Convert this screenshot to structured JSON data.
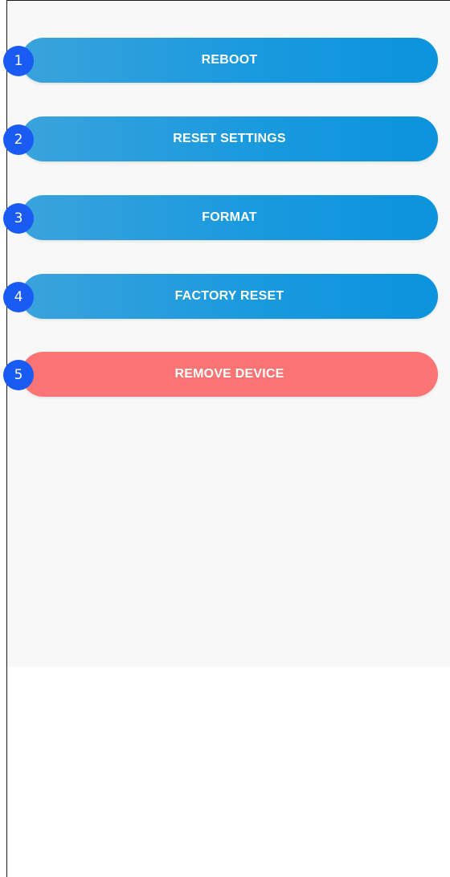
{
  "actions": [
    {
      "number": "1",
      "label": "REBOOT",
      "style": "blue"
    },
    {
      "number": "2",
      "label": "RESET SETTINGS",
      "style": "blue"
    },
    {
      "number": "3",
      "label": "FORMAT",
      "style": "blue"
    },
    {
      "number": "4",
      "label": "FACTORY RESET",
      "style": "blue"
    },
    {
      "number": "5",
      "label": "REMOVE DEVICE",
      "style": "red"
    }
  ],
  "colors": {
    "primary_blue": "#1a9ade",
    "danger_red": "#fb7474",
    "badge_blue": "#1a5cf3",
    "panel_background": "#f8f8f8"
  }
}
